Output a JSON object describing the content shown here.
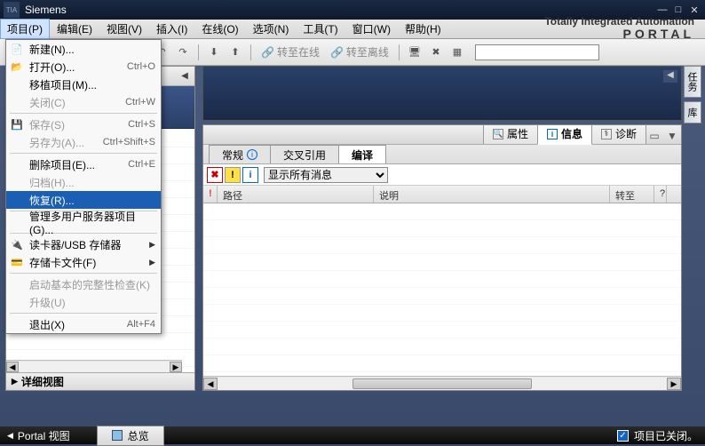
{
  "title": "Siemens",
  "brand": {
    "line1": "Totally Integrated Automation",
    "line2": "PORTAL"
  },
  "menubar": [
    {
      "label": "项目(P)",
      "active": true
    },
    {
      "label": "编辑(E)"
    },
    {
      "label": "视图(V)"
    },
    {
      "label": "插入(I)"
    },
    {
      "label": "在线(O)"
    },
    {
      "label": "选项(N)"
    },
    {
      "label": "工具(T)"
    },
    {
      "label": "窗口(W)"
    },
    {
      "label": "帮助(H)"
    }
  ],
  "toolbar": {
    "go_online": "转至在线",
    "go_offline": "转至离线"
  },
  "project_menu": {
    "new": "新建(N)...",
    "open": "打开(O)...",
    "open_sc": "Ctrl+O",
    "migrate": "移植项目(M)...",
    "close": "关闭(C)",
    "close_sc": "Ctrl+W",
    "save": "保存(S)",
    "save_sc": "Ctrl+S",
    "save_as": "另存为(A)...",
    "save_as_sc": "Ctrl+Shift+S",
    "delete": "删除项目(E)...",
    "delete_sc": "Ctrl+E",
    "archive": "归档(H)...",
    "restore": "恢复(R)...",
    "manage_multi": "管理多用户服务器项目(G)...",
    "card_reader": "读卡器/USB 存储器",
    "mem_card": "存储卡文件(F)",
    "integrity": "启动基本的完整性检查(K)",
    "upgrade": "升级(U)",
    "exit": "退出(X)",
    "exit_sc": "Alt+F4"
  },
  "left_panel": {
    "detail_view": "详细视图"
  },
  "info_panel": {
    "tabs": {
      "prop": "属性",
      "info": "信息",
      "diag": "诊断"
    },
    "subtabs": {
      "general": "常规",
      "xref": "交叉引用",
      "compile": "编译"
    },
    "filter": "显示所有消息",
    "cols": {
      "path": "路径",
      "desc": "说明",
      "goto": "转至",
      "q": "?"
    }
  },
  "side_tabs": {
    "tasks": "任务",
    "lib": "库"
  },
  "status": {
    "portal": "Portal 视图",
    "overview": "总览",
    "closed": "项目已关闭。"
  }
}
